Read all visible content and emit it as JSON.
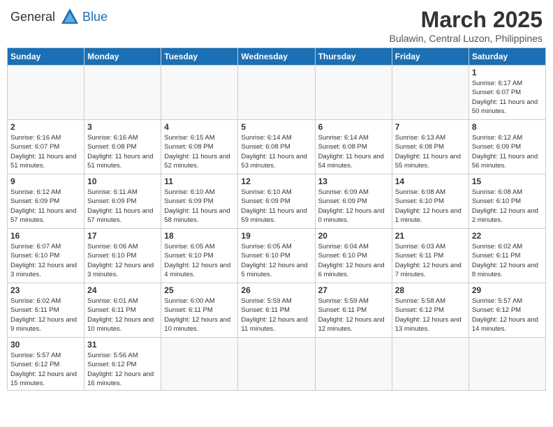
{
  "logo": {
    "general": "General",
    "blue": "Blue"
  },
  "title": {
    "month_year": "March 2025",
    "location": "Bulawin, Central Luzon, Philippines"
  },
  "days_of_week": [
    "Sunday",
    "Monday",
    "Tuesday",
    "Wednesday",
    "Thursday",
    "Friday",
    "Saturday"
  ],
  "weeks": [
    [
      {
        "day": "",
        "info": ""
      },
      {
        "day": "",
        "info": ""
      },
      {
        "day": "",
        "info": ""
      },
      {
        "day": "",
        "info": ""
      },
      {
        "day": "",
        "info": ""
      },
      {
        "day": "",
        "info": ""
      },
      {
        "day": "1",
        "info": "Sunrise: 6:17 AM\nSunset: 6:07 PM\nDaylight: 11 hours\nand 50 minutes."
      }
    ],
    [
      {
        "day": "2",
        "info": "Sunrise: 6:16 AM\nSunset: 6:07 PM\nDaylight: 11 hours\nand 51 minutes."
      },
      {
        "day": "3",
        "info": "Sunrise: 6:16 AM\nSunset: 6:08 PM\nDaylight: 11 hours\nand 51 minutes."
      },
      {
        "day": "4",
        "info": "Sunrise: 6:15 AM\nSunset: 6:08 PM\nDaylight: 11 hours\nand 52 minutes."
      },
      {
        "day": "5",
        "info": "Sunrise: 6:14 AM\nSunset: 6:08 PM\nDaylight: 11 hours\nand 53 minutes."
      },
      {
        "day": "6",
        "info": "Sunrise: 6:14 AM\nSunset: 6:08 PM\nDaylight: 11 hours\nand 54 minutes."
      },
      {
        "day": "7",
        "info": "Sunrise: 6:13 AM\nSunset: 6:08 PM\nDaylight: 11 hours\nand 55 minutes."
      },
      {
        "day": "8",
        "info": "Sunrise: 6:12 AM\nSunset: 6:09 PM\nDaylight: 11 hours\nand 56 minutes."
      }
    ],
    [
      {
        "day": "9",
        "info": "Sunrise: 6:12 AM\nSunset: 6:09 PM\nDaylight: 11 hours\nand 57 minutes."
      },
      {
        "day": "10",
        "info": "Sunrise: 6:11 AM\nSunset: 6:09 PM\nDaylight: 11 hours\nand 57 minutes."
      },
      {
        "day": "11",
        "info": "Sunrise: 6:10 AM\nSunset: 6:09 PM\nDaylight: 11 hours\nand 58 minutes."
      },
      {
        "day": "12",
        "info": "Sunrise: 6:10 AM\nSunset: 6:09 PM\nDaylight: 11 hours\nand 59 minutes."
      },
      {
        "day": "13",
        "info": "Sunrise: 6:09 AM\nSunset: 6:09 PM\nDaylight: 12 hours\nand 0 minutes."
      },
      {
        "day": "14",
        "info": "Sunrise: 6:08 AM\nSunset: 6:10 PM\nDaylight: 12 hours\nand 1 minute."
      },
      {
        "day": "15",
        "info": "Sunrise: 6:08 AM\nSunset: 6:10 PM\nDaylight: 12 hours\nand 2 minutes."
      }
    ],
    [
      {
        "day": "16",
        "info": "Sunrise: 6:07 AM\nSunset: 6:10 PM\nDaylight: 12 hours\nand 3 minutes."
      },
      {
        "day": "17",
        "info": "Sunrise: 6:06 AM\nSunset: 6:10 PM\nDaylight: 12 hours\nand 3 minutes."
      },
      {
        "day": "18",
        "info": "Sunrise: 6:05 AM\nSunset: 6:10 PM\nDaylight: 12 hours\nand 4 minutes."
      },
      {
        "day": "19",
        "info": "Sunrise: 6:05 AM\nSunset: 6:10 PM\nDaylight: 12 hours\nand 5 minutes."
      },
      {
        "day": "20",
        "info": "Sunrise: 6:04 AM\nSunset: 6:10 PM\nDaylight: 12 hours\nand 6 minutes."
      },
      {
        "day": "21",
        "info": "Sunrise: 6:03 AM\nSunset: 6:11 PM\nDaylight: 12 hours\nand 7 minutes."
      },
      {
        "day": "22",
        "info": "Sunrise: 6:02 AM\nSunset: 6:11 PM\nDaylight: 12 hours\nand 8 minutes."
      }
    ],
    [
      {
        "day": "23",
        "info": "Sunrise: 6:02 AM\nSunset: 6:11 PM\nDaylight: 12 hours\nand 9 minutes."
      },
      {
        "day": "24",
        "info": "Sunrise: 6:01 AM\nSunset: 6:11 PM\nDaylight: 12 hours\nand 10 minutes."
      },
      {
        "day": "25",
        "info": "Sunrise: 6:00 AM\nSunset: 6:11 PM\nDaylight: 12 hours\nand 10 minutes."
      },
      {
        "day": "26",
        "info": "Sunrise: 5:59 AM\nSunset: 6:11 PM\nDaylight: 12 hours\nand 11 minutes."
      },
      {
        "day": "27",
        "info": "Sunrise: 5:59 AM\nSunset: 6:11 PM\nDaylight: 12 hours\nand 12 minutes."
      },
      {
        "day": "28",
        "info": "Sunrise: 5:58 AM\nSunset: 6:12 PM\nDaylight: 12 hours\nand 13 minutes."
      },
      {
        "day": "29",
        "info": "Sunrise: 5:57 AM\nSunset: 6:12 PM\nDaylight: 12 hours\nand 14 minutes."
      }
    ],
    [
      {
        "day": "30",
        "info": "Sunrise: 5:57 AM\nSunset: 6:12 PM\nDaylight: 12 hours\nand 15 minutes."
      },
      {
        "day": "31",
        "info": "Sunrise: 5:56 AM\nSunset: 6:12 PM\nDaylight: 12 hours\nand 16 minutes."
      },
      {
        "day": "",
        "info": ""
      },
      {
        "day": "",
        "info": ""
      },
      {
        "day": "",
        "info": ""
      },
      {
        "day": "",
        "info": ""
      },
      {
        "day": "",
        "info": ""
      }
    ]
  ]
}
